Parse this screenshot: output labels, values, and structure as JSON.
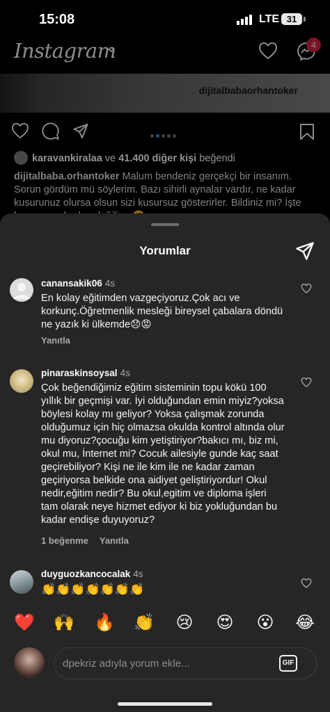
{
  "status_bar": {
    "time": "15:08",
    "network": "LTE",
    "battery": "31"
  },
  "header": {
    "logo": "Instagram",
    "messages_badge": "4"
  },
  "post": {
    "watermark": "dijitalbabaorhantoker",
    "liked_by_user": "karavankiralaa",
    "liked_by_joiner": " ve ",
    "liked_by_others": "41.400 diğer kişi",
    "liked_by_suffix": " beğendi",
    "caption_user": "dijitalbaba.orhantoker",
    "caption_text": " Malum bendeniz gerçekçi bir insanım. Sorun gördüm mü söylerim. Bazı sihirli aynalar vardır, ne kadar kusurunuz olursa olsun sizi kusursuz gösterirler. Bildiniz mi? İşte ben o aynalardan değilim. 🤗"
  },
  "comments_sheet": {
    "title": "Yorumlar",
    "comments": [
      {
        "username": "canansakik06",
        "age": "4s",
        "text": "En kolay eğitimden vazgeçiyoruz.Çok acı ve korkunç.Öğretmenlik mesleği bireysel çabalara döndü ne yazık ki ülkemde😞😡",
        "reply_label": "Yanıtla"
      },
      {
        "username": "pinaraskinsoysal",
        "age": "4s",
        "text": "Çok beğendiğimiz eğitim sisteminin topu kökü 100 yıllık bir geçmişi var. İyi olduğundan emin miyiz?yoksa böylesi kolay mı geliyor? Yoksa çalışmak zorunda olduğumuz için hiç olmazsa okulda kontrol altında olur mu diyoruz?çocuğu kim yetiştiriyor?bakıcı mı, biz mi, okul mu, İnternet mi? Cocuk ailesiyle gunde kaç saat geçirebiliyor? Kişi ne ile kim ile ne kadar zaman geçiriyorsa belkide ona aidiyet geliştiriyordur! Okul nedir,eğitim nedir? Bu okul,egitim ve diploma işleri tam olarak neye hizmet ediyor ki biz yokluğundan bu kadar endişe duyuyoruz?",
        "likes_label": "1 beğenme",
        "reply_label": "Yanıtla"
      },
      {
        "username": "duyguozkancocalak",
        "age": "4s",
        "text": "👏👏👏👏👏👏👏"
      }
    ],
    "quick_emojis": [
      "❤️",
      "🙌",
      "🔥",
      "👏",
      "😢",
      "😍",
      "😮",
      "😂"
    ],
    "input": {
      "placeholder": "dpekriz adıyla yorum ekle...",
      "value": "",
      "gif_label": "GIF"
    }
  },
  "colors": {
    "sheet_bg": "#262626",
    "badge": "#e0244a",
    "like_heart": "#ff3040"
  }
}
